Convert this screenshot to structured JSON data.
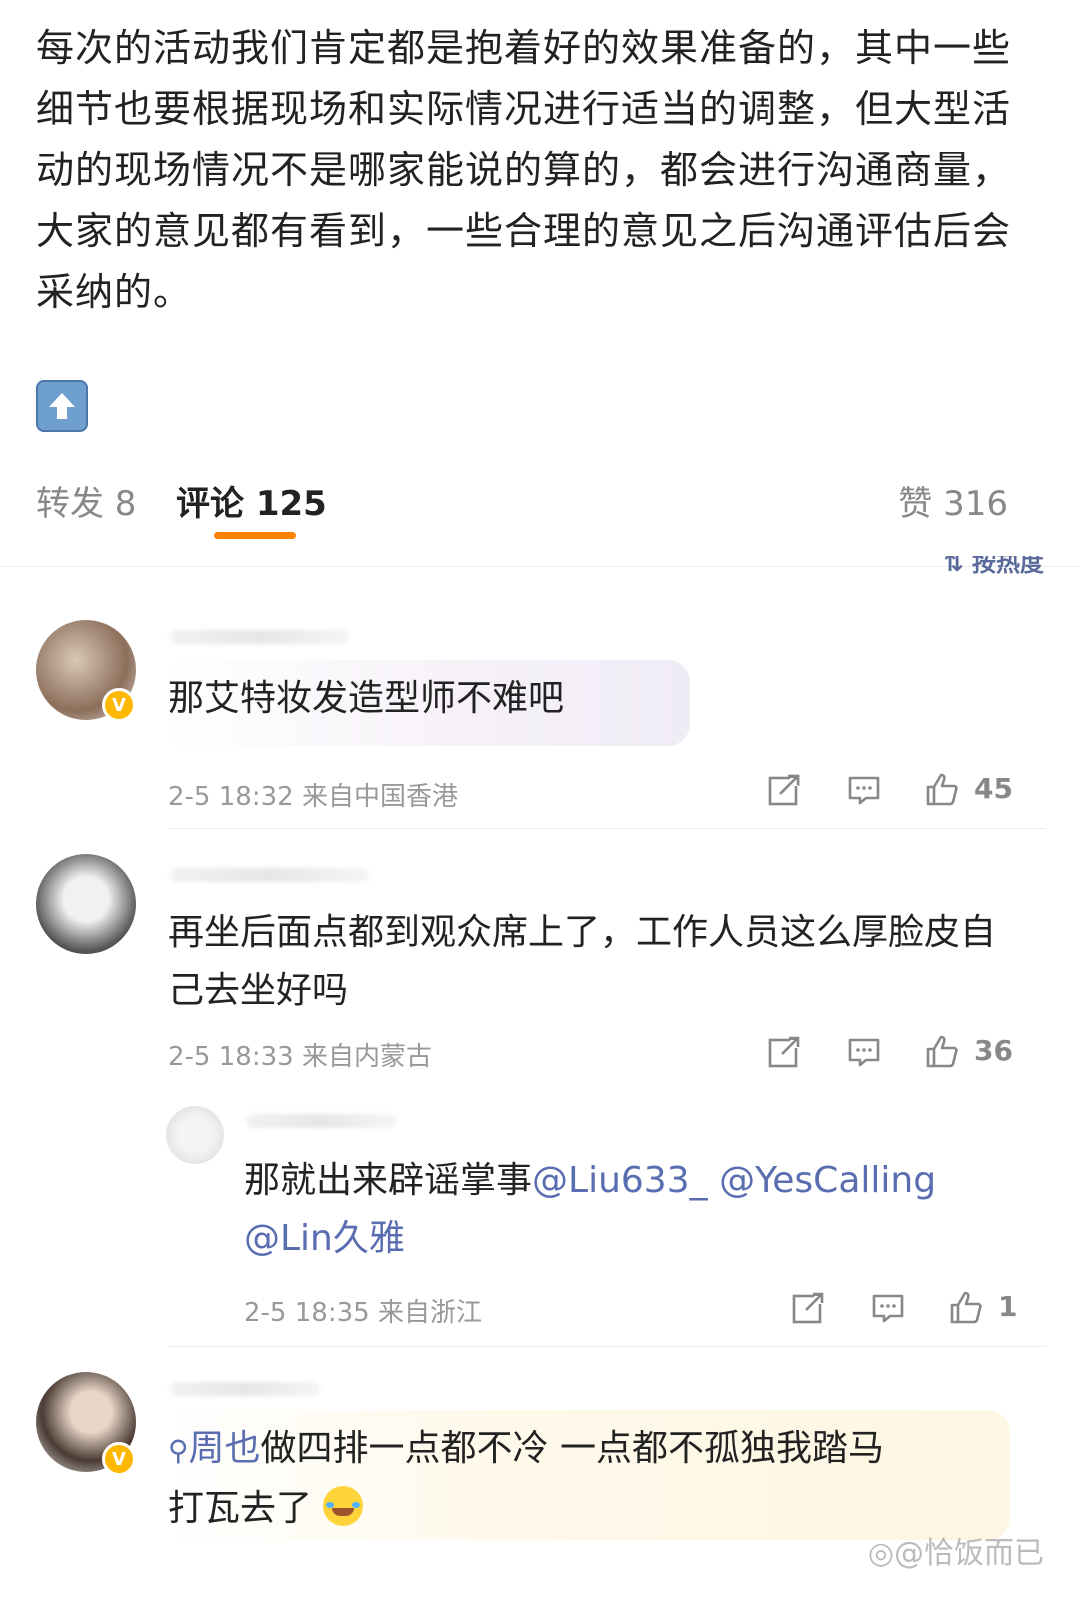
{
  "post": {
    "text": "每次的活动我们肯定都是抱着好的效果准备的，其中一些细节也要根据现场和实际情况进行适当的调整，但大型活动的现场情况不是哪家能说的算的，都会进行沟通商量，大家的意见都有看到，一些合理的意见之后沟通评估后会采纳的。"
  },
  "tabs": {
    "repost": "转发 8",
    "comments": "评论 125",
    "likes": "赞 316",
    "sort": "按热度"
  },
  "comments": [
    {
      "text": "那艾特妆发造型师不难吧",
      "time": "2-5 18:32",
      "location": "来自中国香港",
      "likes": "45"
    },
    {
      "text": "再坐后面点都到观众席上了，工作人员这么厚脸皮自己去坐好吗",
      "time": "2-5 18:33",
      "location": "来自内蒙古",
      "likes": "36"
    }
  ],
  "reply": {
    "text": "那就出来辟谣掌事",
    "mention1": "@Liu633_",
    "mention2": "@YesCalling",
    "mention3": "@Lin久雅",
    "time": "2-5 18:35",
    "location": "来自浙江",
    "likes": "1"
  },
  "comment3": {
    "topic": "周也",
    "text_part1": "做四排一点都不冷 一点都不孤独我踏马",
    "text_part2": "打瓦去了"
  },
  "watermark": "@恰饭而已",
  "colors": {
    "accent": "#ff8200",
    "mention": "#5a6db0",
    "vip_badge": "#ffb800"
  }
}
